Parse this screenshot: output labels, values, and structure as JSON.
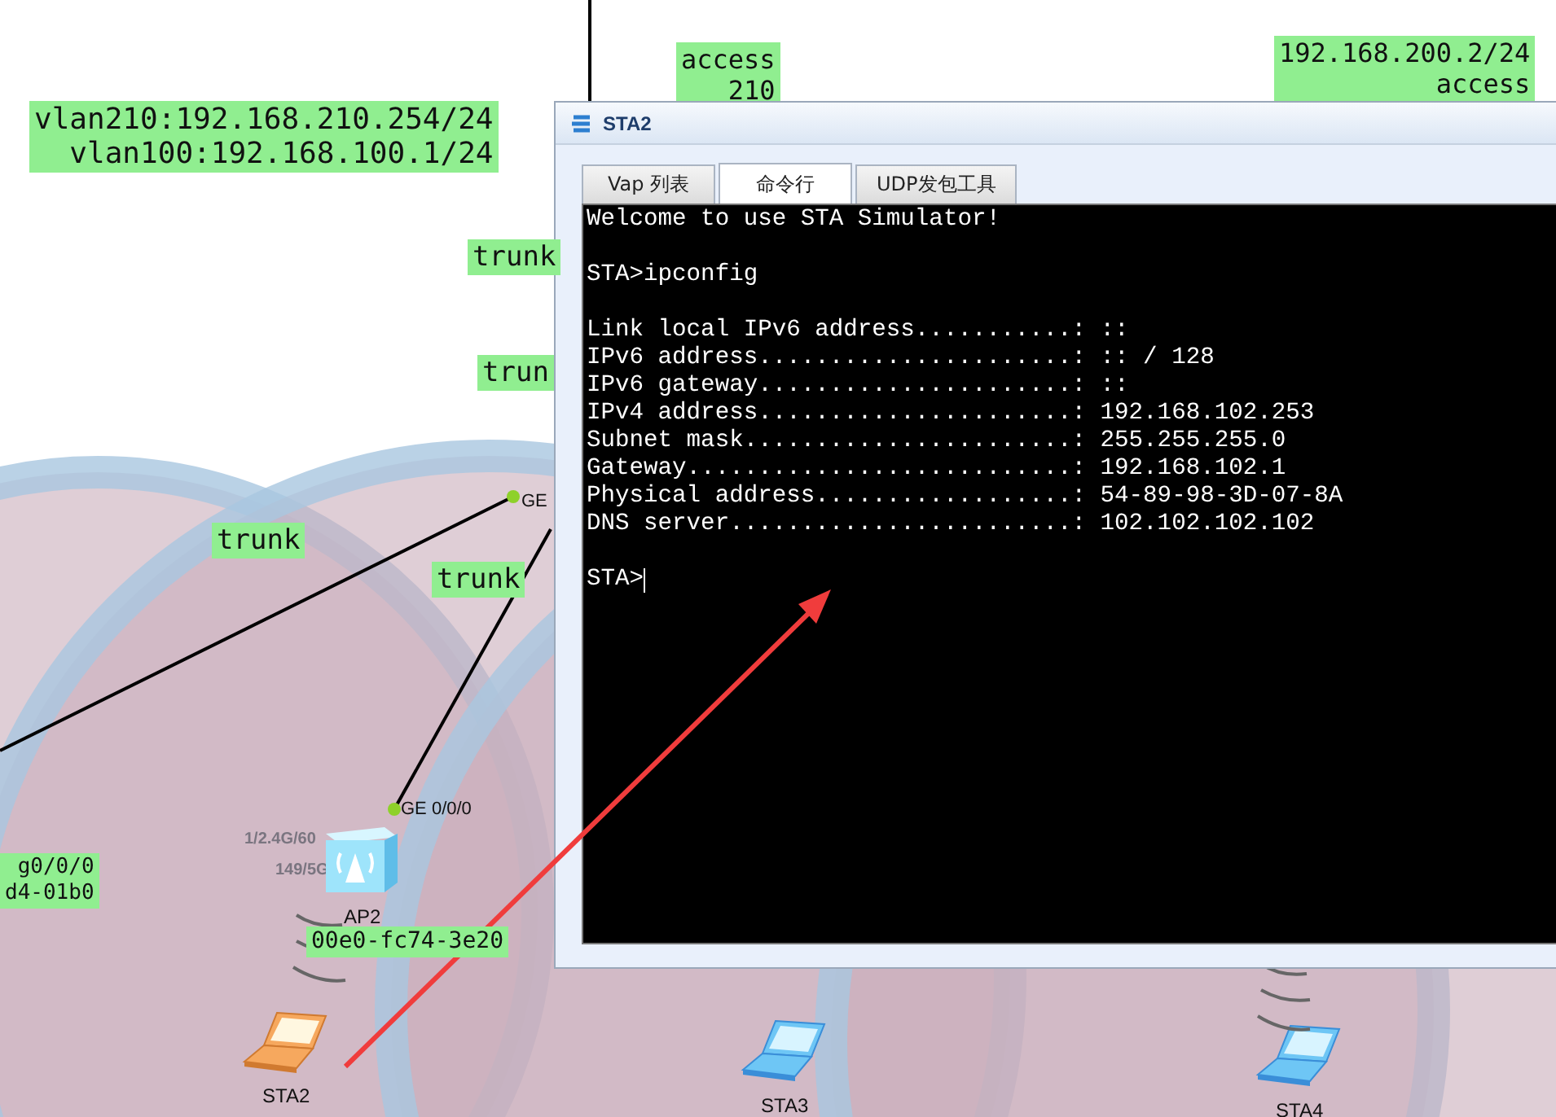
{
  "canvas": {
    "labels": [
      {
        "lines": [
          "vlan210:192.168.210.254/24",
          "vlan100:192.168.100.1/24"
        ]
      },
      {
        "lines": [
          "access",
          "210"
        ]
      },
      {
        "lines": [
          "192.168.200.2/24",
          "access"
        ]
      },
      {
        "lines": [
          "trunk"
        ]
      },
      {
        "lines": [
          "trun"
        ]
      },
      {
        "lines": [
          "trunk"
        ]
      },
      {
        "lines": [
          "trunk"
        ]
      },
      {
        "lines": [
          "g0/0/0",
          "d4-01b0"
        ]
      },
      {
        "lines": [
          "00e0-fc74-3e20"
        ]
      }
    ],
    "ports": [
      {
        "label": "GE"
      },
      {
        "label": "GE 0/0/0"
      }
    ],
    "devices": [
      {
        "kind": "ap",
        "name": "AP2",
        "radio_labels": [
          "1/2.4G/60",
          "149/5G"
        ]
      },
      {
        "kind": "laptop",
        "name": "STA2",
        "selected": true
      },
      {
        "kind": "laptop",
        "name": "STA3",
        "selected": false
      },
      {
        "kind": "laptop",
        "name": "STA4",
        "selected": false
      }
    ]
  },
  "window": {
    "title": "STA2",
    "tabs": [
      {
        "label": "Vap 列表",
        "selected": false
      },
      {
        "label": "命令行",
        "selected": true
      },
      {
        "label": "UDP发包工具",
        "selected": false
      }
    ],
    "console": {
      "blocks": [
        [
          "Welcome to use STA Simulator!"
        ],
        [
          "STA>ipconfig"
        ],
        [
          "Link local IPv6 address...........: ::",
          "IPv6 address......................: :: / 128",
          "IPv6 gateway......................: ::",
          "IPv4 address......................: 192.168.102.253",
          "Subnet mask.......................: 255.255.255.0",
          "Gateway...........................: 192.168.102.1",
          "Physical address..................: 54-89-98-3D-07-8A",
          "DNS server........................: 102.102.102.102"
        ]
      ],
      "prompt": "STA>"
    }
  }
}
